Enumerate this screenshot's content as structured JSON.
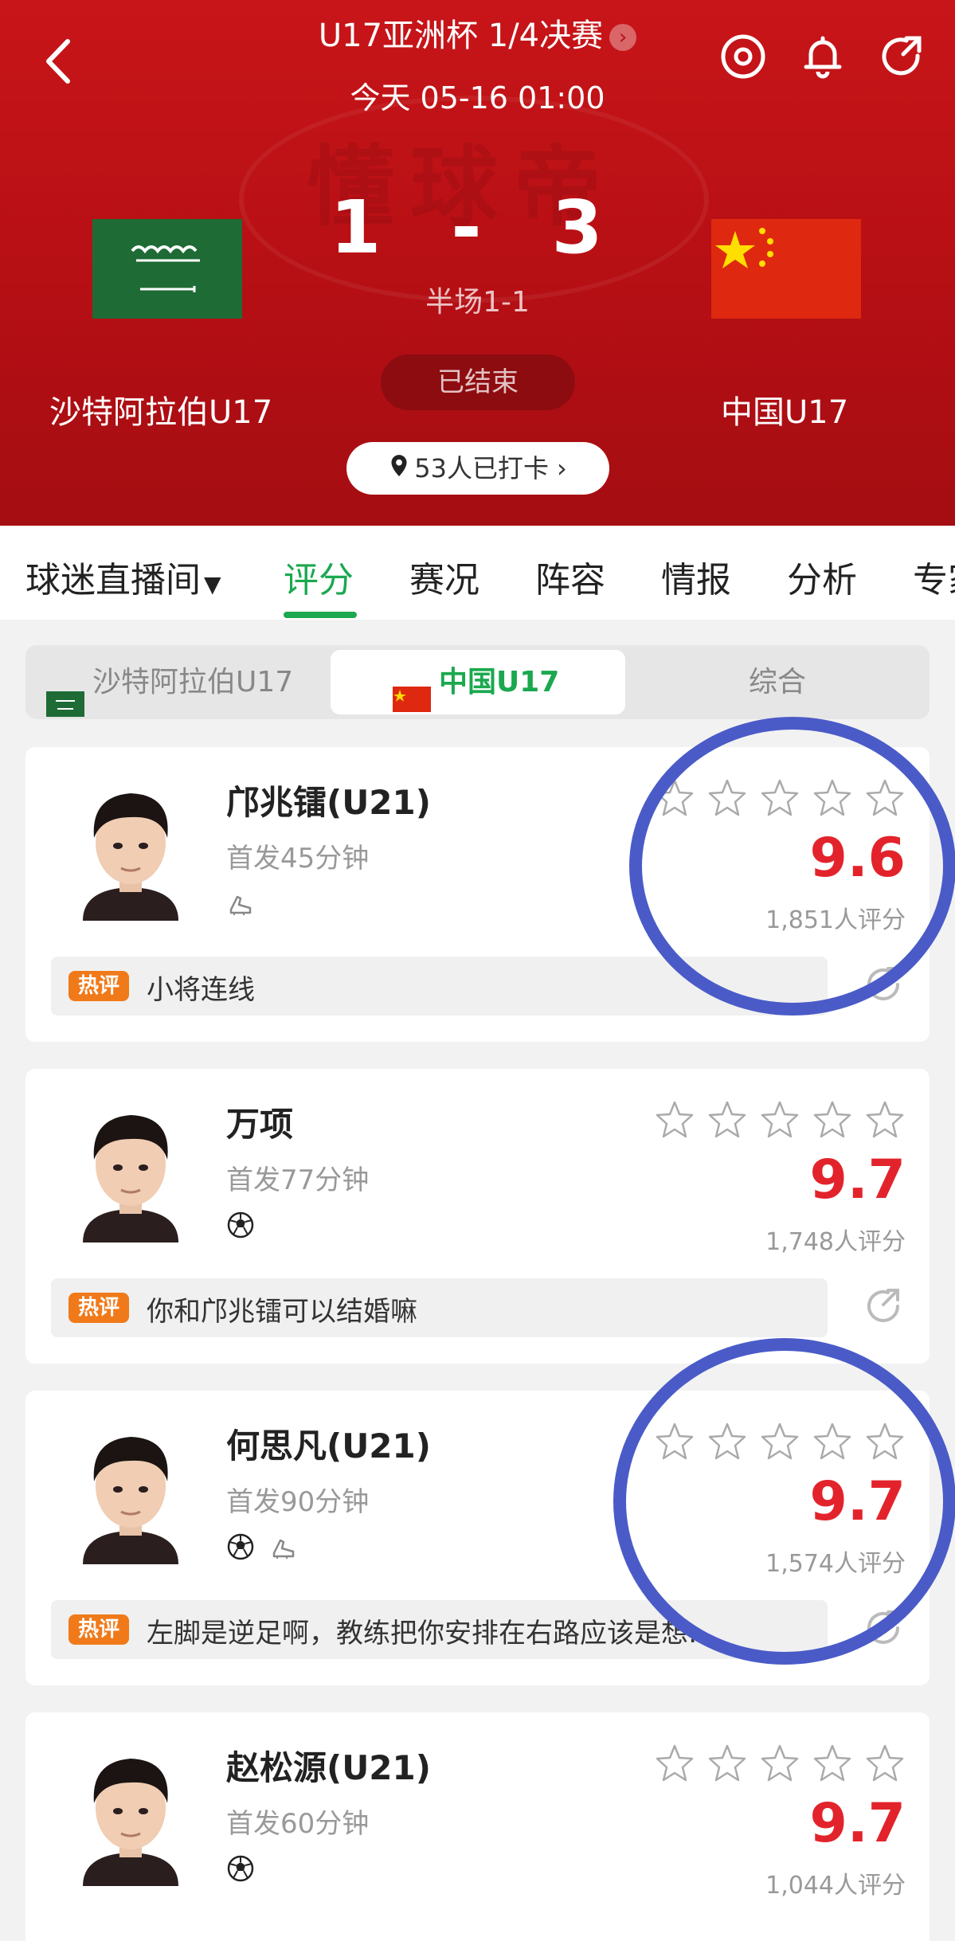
{
  "header": {
    "match_title": "U17亚洲杯 1/4决赛",
    "match_time": "今天 05-16 01:00",
    "score": "1 - 3",
    "halftime": "半场1-1",
    "home_team": "沙特阿拉伯U17",
    "away_team": "中国U17",
    "status": "已结束",
    "checkin": "53人已打卡",
    "watermark": "懂球帝",
    "colors": {
      "header_red": "#c81519",
      "accent_green": "#1ba84f",
      "rating_red": "#e3232b",
      "hot_orange": "#f07a1a"
    }
  },
  "tabs": [
    {
      "label": "球迷直播间"
    },
    {
      "label": "评分"
    },
    {
      "label": "赛况"
    },
    {
      "label": "阵容"
    },
    {
      "label": "情报"
    },
    {
      "label": "分析"
    },
    {
      "label": "专家"
    }
  ],
  "team_switch": [
    {
      "label": "沙特阿拉伯U17"
    },
    {
      "label": "中国U17"
    },
    {
      "label": "综合"
    }
  ],
  "players": [
    {
      "name": "邝兆镭(U21)",
      "info": "首发45分钟",
      "icons": [
        "boot-icon"
      ],
      "rating": "9.6",
      "count": "1,851人评分",
      "hot_label": "热评",
      "comment": "小将连线"
    },
    {
      "name": "万项",
      "info": "首发77分钟",
      "icons": [
        "ball-icon"
      ],
      "rating": "9.7",
      "count": "1,748人评分",
      "hot_label": "热评",
      "comment": "你和邝兆镭可以结婚嘛"
    },
    {
      "name": "何思凡(U21)",
      "info": "首发90分钟",
      "icons": [
        "ball-icon",
        "boot-icon"
      ],
      "rating": "9.7",
      "count": "1,574人评分",
      "hot_label": "热评",
      "comment": "左脚是逆足啊，教练把你安排在右路应该是想…"
    },
    {
      "name": "赵松源(U21)",
      "info": "首发60分钟",
      "icons": [
        "ball-icon"
      ],
      "rating": "9.7",
      "count": "1,044人评分"
    }
  ],
  "annotation_color": "#4a5bc8"
}
